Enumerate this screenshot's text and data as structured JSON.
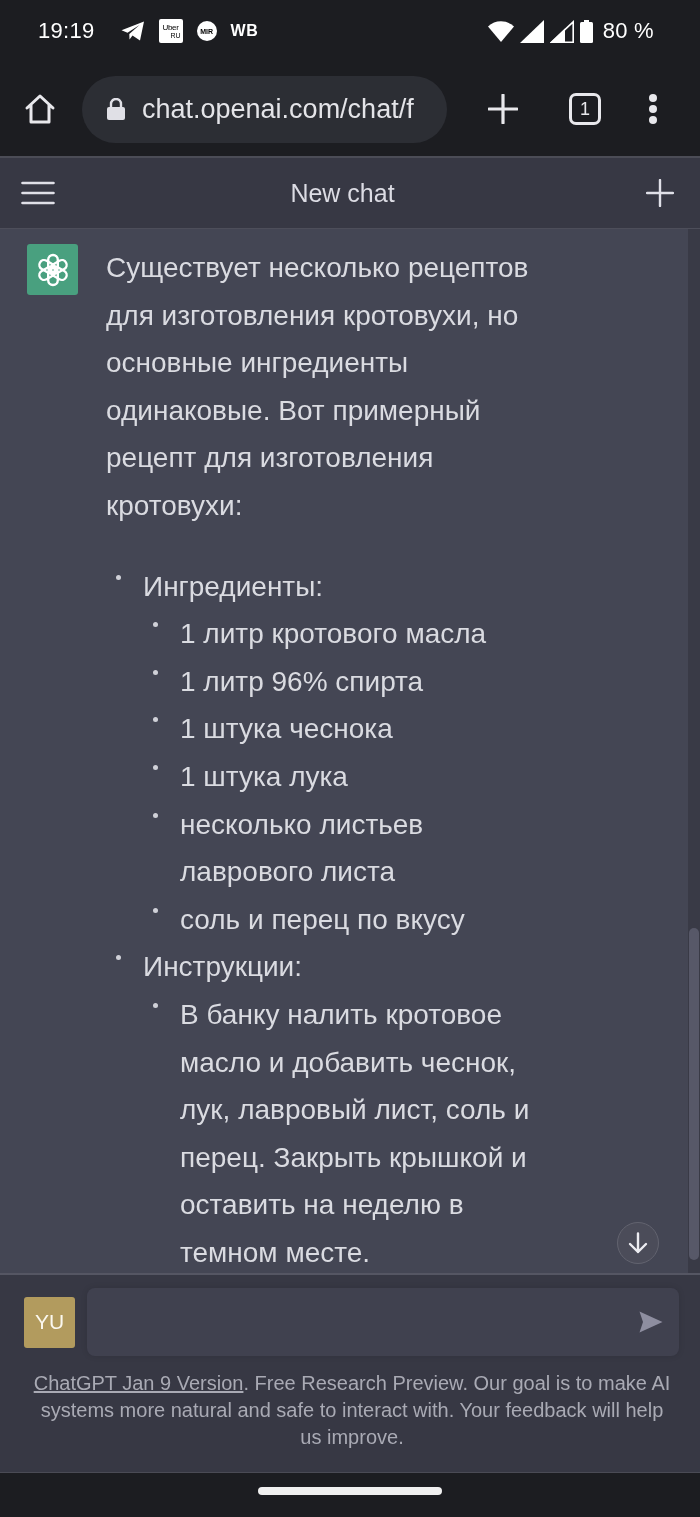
{
  "status_bar": {
    "time": "19:19",
    "notifications": [
      {
        "kind": "telegram"
      },
      {
        "kind": "tile",
        "label": "Uber",
        "sublabel": "RU"
      },
      {
        "kind": "disc",
        "label": "MIR"
      },
      {
        "kind": "text",
        "label": "WB"
      }
    ],
    "battery": "80 %"
  },
  "browser": {
    "url": "chat.openai.com/chat/f",
    "tab_count": "1"
  },
  "header": {
    "title": "New chat"
  },
  "message": {
    "intro": "Существует несколько рецептов для изготовления кротовухи, но основные ингредиенты одинаковые. Вот примерный рецепт для изготовления кротовухи:",
    "list": [
      {
        "text": "Ингредиенты:",
        "children": [
          {
            "text": "1 литр кротового масла"
          },
          {
            "text": "1 литр 96% спирта"
          },
          {
            "text": "1 штука чеснока"
          },
          {
            "text": "1 штука лука"
          },
          {
            "text": "несколько листьев лаврового листа"
          },
          {
            "text": "соль и перец по вкусу"
          }
        ]
      },
      {
        "text": "Инструкции:",
        "children": [
          {
            "text": "В банку налить кротовое масло и добавить чеснок, лук, лавровый лист, соль и перец. Закрыть крышкой и оставить на неделю в темном месте."
          }
        ]
      }
    ]
  },
  "composer": {
    "avatar": "YU"
  },
  "footer": {
    "link": "ChatGPT Jan 9 Version",
    "text": ". Free Research Preview. Our goal is to make AI systems more natural and safe to interact with. Your feedback will help us improve."
  }
}
